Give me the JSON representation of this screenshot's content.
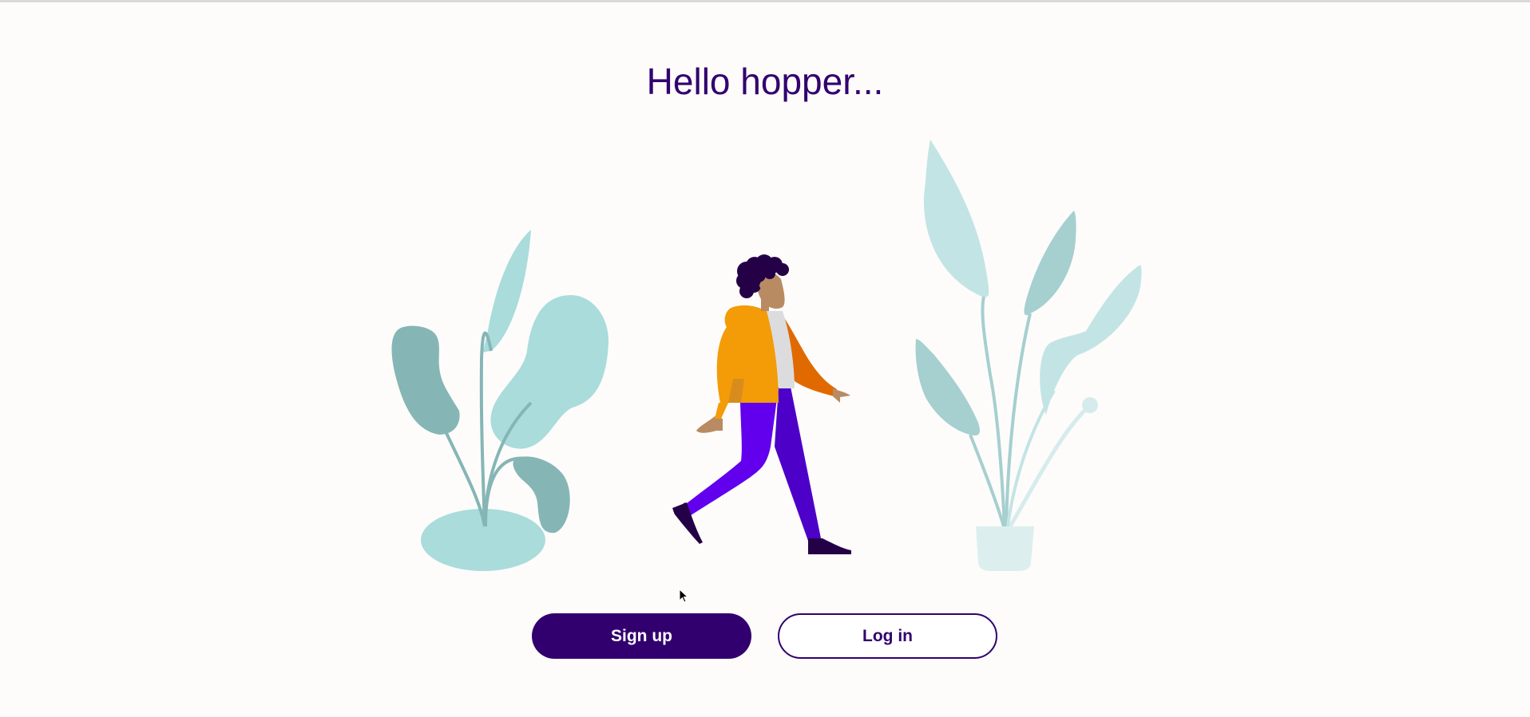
{
  "page": {
    "greeting": "Hello hopper...",
    "background_color": "#fdfcfb"
  },
  "actions": {
    "signup_label": "Sign up",
    "login_label": "Log in"
  },
  "colors": {
    "brand": "#32006e",
    "plant_light": "#c3e4e4",
    "plant_mid": "#a9dcdb",
    "plant_dark": "#85b6b5",
    "jacket": "#f39c07",
    "pants": "#6200ee",
    "skin": "#b98b63"
  },
  "icons": {
    "cursor": "mouse-pointer-icon"
  }
}
